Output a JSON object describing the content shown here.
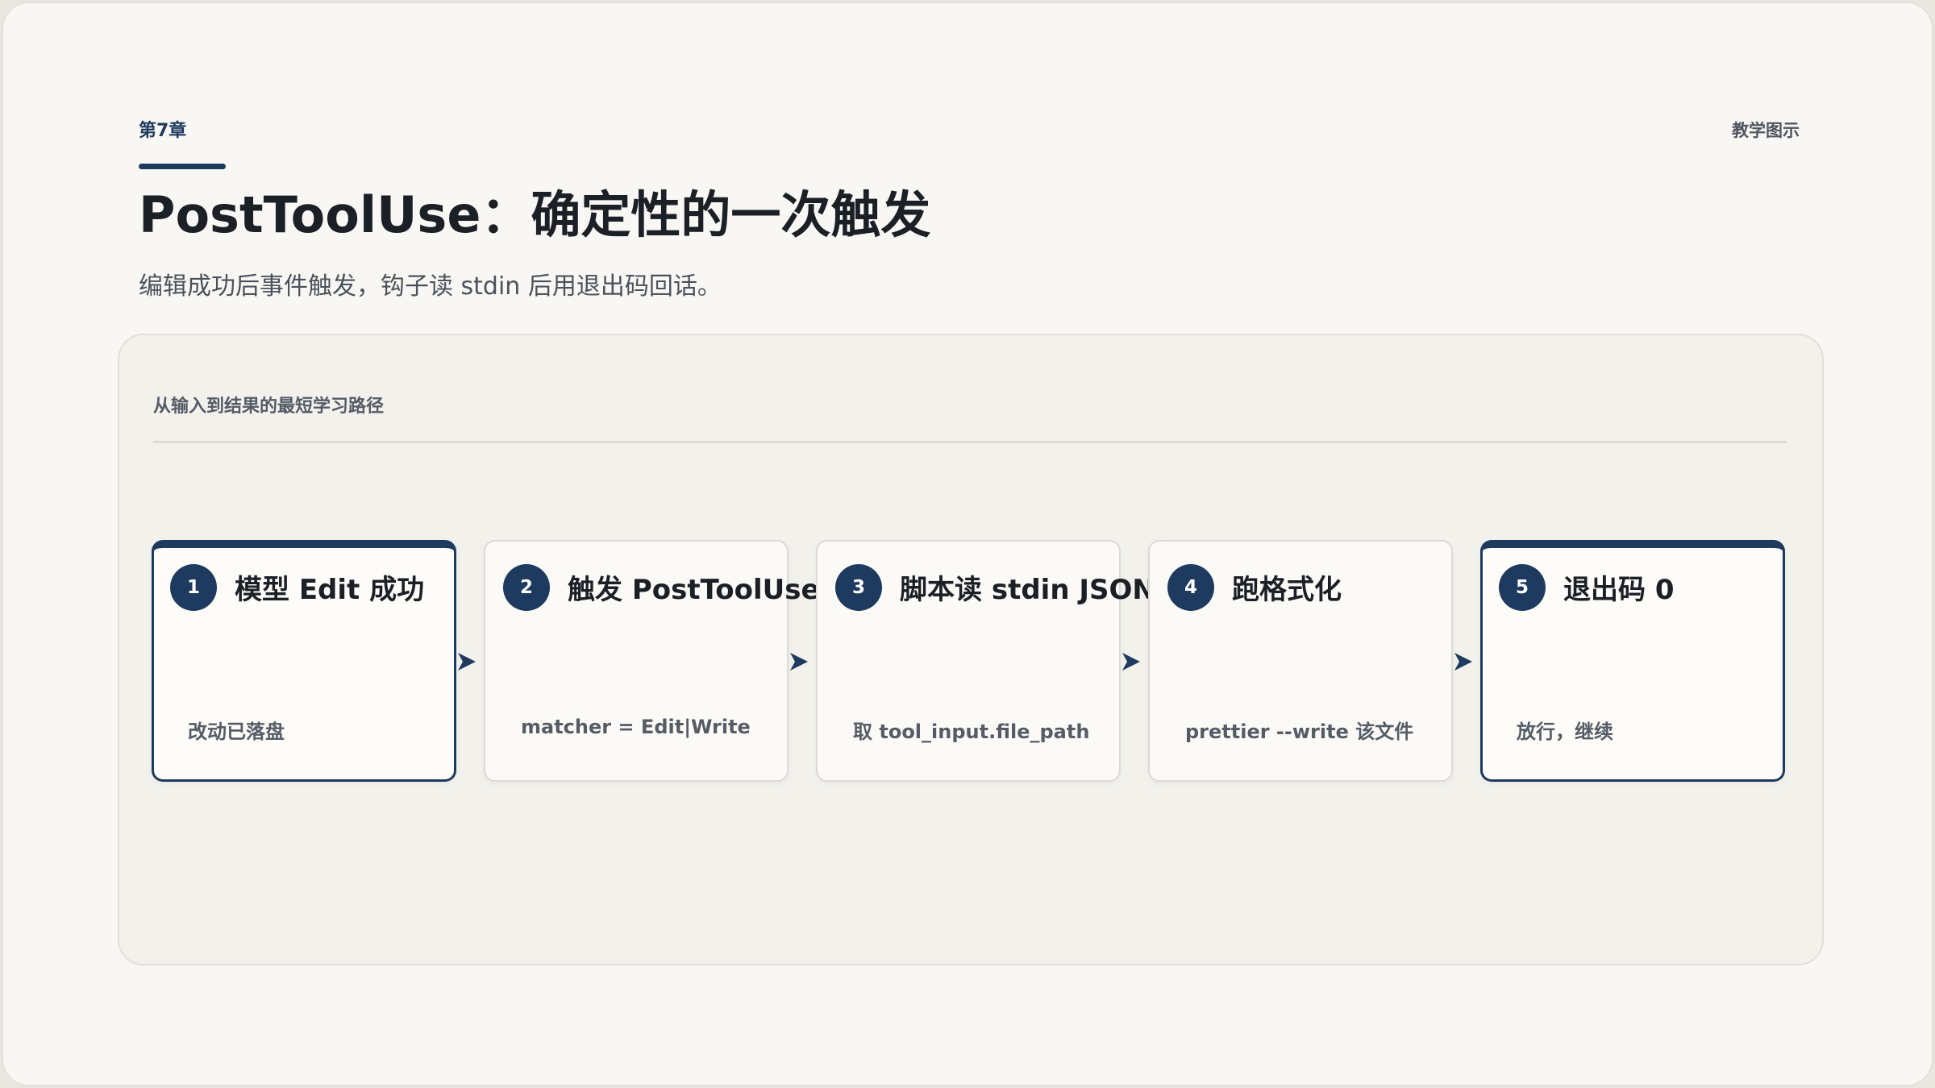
{
  "header": {
    "chapter": "第7章",
    "tag": "教学图示",
    "title": "PostToolUse：确定性的一次触发",
    "subtitle": "编辑成功后事件触发，钩子读 stdin 后用退出码回话。"
  },
  "panel": {
    "label": "从输入到结果的最短学习路径"
  },
  "steps": [
    {
      "num": "1",
      "title": "模型 Edit 成功",
      "desc": "改动已落盘",
      "emphasis": true
    },
    {
      "num": "2",
      "title": "触发 PostToolUse",
      "desc": "matcher = Edit|Write",
      "emphasis": false
    },
    {
      "num": "3",
      "title": "脚本读 stdin JSON",
      "desc": "取 tool_input.file_path",
      "emphasis": false
    },
    {
      "num": "4",
      "title": "跑格式化",
      "desc": "prettier --write 该文件",
      "emphasis": false
    },
    {
      "num": "5",
      "title": "退出码 0",
      "desc": "放行，继续",
      "emphasis": true
    }
  ],
  "colors": {
    "accent": "#1e3a5f",
    "background": "#f8f7f3",
    "panel": "#f2f1ec"
  }
}
